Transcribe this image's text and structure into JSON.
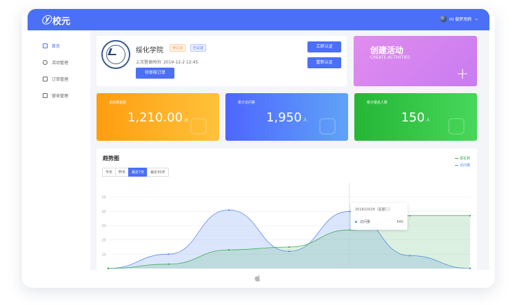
{
  "app": {
    "logo": "校元",
    "user_greeting": "Hi 做梦用称"
  },
  "sidebar": {
    "items": [
      {
        "label": "首页",
        "icon": "home-icon",
        "active": true
      },
      {
        "label": "活动管理",
        "icon": "clock-icon",
        "active": false
      },
      {
        "label": "订单管理",
        "icon": "document-icon",
        "active": false
      },
      {
        "label": "营收管理",
        "icon": "wallet-icon",
        "active": false
      }
    ]
  },
  "school": {
    "name": "绥化学院",
    "tag_pending": "待认证",
    "tag_verified": "已认证",
    "last_login_label": "上次登录时间:",
    "last_login_value": "2019-12-2 12:45",
    "pending_orders_button": "待审核订单",
    "verify_button": "立即认证",
    "reverify_button": "重新认证"
  },
  "create_activity": {
    "title": "创建活动",
    "subtitle": "CREATE ACTIVITIES",
    "plus": "+"
  },
  "stats": [
    {
      "label": "未结算金额",
      "value": "1,210.00",
      "unit": "元",
      "color": "#ffa21a"
    },
    {
      "label": "累计访问量",
      "value": "1,950",
      "unit": "人",
      "color": "#4e66ff"
    },
    {
      "label": "累计报名人数",
      "value": "150",
      "unit": "人",
      "color": "#2cbb3c"
    }
  ],
  "trend": {
    "title": "趋势图",
    "tabs": [
      "今天",
      "昨天",
      "最近7天",
      "最近30天"
    ],
    "active_tab": "最近7天",
    "legend": [
      {
        "name": "报名数",
        "color": "#3cae56"
      },
      {
        "name": "访问量",
        "color": "#5b8cf0"
      }
    ],
    "tooltip": {
      "date": "2019/10/29（星期二）",
      "series": "访问量",
      "value": "540"
    }
  },
  "chart_data": {
    "type": "area",
    "y_ticks": [
      "50",
      "40",
      "30",
      "20",
      "10"
    ],
    "ylim": [
      0,
      60
    ],
    "grid": true,
    "legend_position": "top-right",
    "series": [
      {
        "name": "访问量",
        "color": "#5b8cf0",
        "values": [
          0,
          10,
          41,
          12,
          40,
          9,
          0
        ]
      },
      {
        "name": "报名数",
        "color": "#3cae56",
        "values": [
          0,
          3,
          13,
          15,
          27,
          37,
          37
        ]
      }
    ]
  }
}
